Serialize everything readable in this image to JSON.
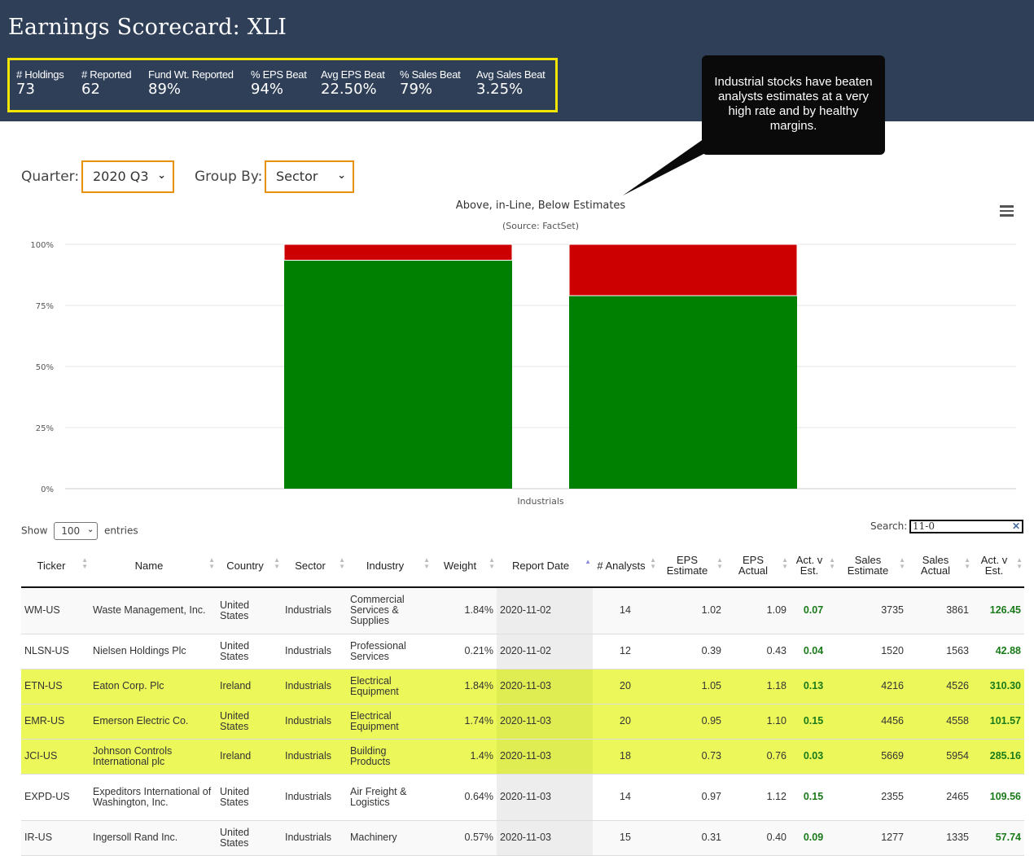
{
  "header": {
    "title": "Earnings Scorecard: XLI",
    "stats": [
      {
        "label": "# Holdings",
        "value": "73"
      },
      {
        "label": "# Reported",
        "value": "62"
      },
      {
        "label": "Fund Wt. Reported",
        "value": "89%"
      },
      {
        "label": "% EPS Beat",
        "value": "94%"
      },
      {
        "label": "Avg EPS Beat",
        "value": "22.50%"
      },
      {
        "label": "% Sales Beat",
        "value": "79%"
      },
      {
        "label": "Avg Sales Beat",
        "value": "3.25%"
      }
    ]
  },
  "callout": "Industrial stocks have beaten analysts estimates at a very high rate and by healthy margins.",
  "controls": {
    "quarter_label": "Quarter:",
    "quarter_value": "2020 Q3",
    "group_label": "Group By:",
    "group_value": "Sector"
  },
  "chart_data": {
    "type": "bar",
    "title": "Above, in-Line, Below Estimates",
    "subtitle": "(Source: FactSet)",
    "categories": [
      "Industrials"
    ],
    "y_ticks": [
      "0%",
      "25%",
      "50%",
      "75%",
      "100%"
    ],
    "ylim": [
      0,
      100
    ],
    "stacked": true,
    "bars": [
      {
        "above": 93.5,
        "below": 6.5
      },
      {
        "above": 79,
        "below": 21
      }
    ],
    "colors": {
      "above": "#008000",
      "below": "#cc0000"
    }
  },
  "table_controls": {
    "show_label": "Show",
    "entries_value": "100",
    "entries_label": "entries",
    "search_label": "Search:",
    "search_value": "11-0"
  },
  "table": {
    "headers": [
      "Ticker",
      "Name",
      "Country",
      "Sector",
      "Industry",
      "Weight",
      "Report Date",
      "# Analysts",
      "EPS Estimate",
      "EPS Actual",
      "Act. v Est.",
      "Sales Estimate",
      "Sales Actual",
      "Act. v Est."
    ],
    "rows": [
      {
        "ticker": "WM-US",
        "name": "Waste Management, Inc.",
        "country": "United States",
        "sector": "Industrials",
        "industry": "Commercial Services & Supplies",
        "weight": "1.84%",
        "date": "2020-11-02",
        "analysts": "14",
        "eps_est": "1.02",
        "eps_act": "1.09",
        "eps_diff": "0.07",
        "sales_est": "3735",
        "sales_act": "3861",
        "sales_diff": "126.45",
        "highlight": false
      },
      {
        "ticker": "NLSN-US",
        "name": "Nielsen Holdings Plc",
        "country": "United States",
        "sector": "Industrials",
        "industry": "Professional Services",
        "weight": "0.21%",
        "date": "2020-11-02",
        "analysts": "12",
        "eps_est": "0.39",
        "eps_act": "0.43",
        "eps_diff": "0.04",
        "sales_est": "1520",
        "sales_act": "1563",
        "sales_diff": "42.88",
        "highlight": false
      },
      {
        "ticker": "ETN-US",
        "name": "Eaton Corp. Plc",
        "country": "Ireland",
        "sector": "Industrials",
        "industry": "Electrical Equipment",
        "weight": "1.84%",
        "date": "2020-11-03",
        "analysts": "20",
        "eps_est": "1.05",
        "eps_act": "1.18",
        "eps_diff": "0.13",
        "sales_est": "4216",
        "sales_act": "4526",
        "sales_diff": "310.30",
        "highlight": true
      },
      {
        "ticker": "EMR-US",
        "name": "Emerson Electric Co.",
        "country": "United States",
        "sector": "Industrials",
        "industry": "Electrical Equipment",
        "weight": "1.74%",
        "date": "2020-11-03",
        "analysts": "20",
        "eps_est": "0.95",
        "eps_act": "1.10",
        "eps_diff": "0.15",
        "sales_est": "4456",
        "sales_act": "4558",
        "sales_diff": "101.57",
        "highlight": true
      },
      {
        "ticker": "JCI-US",
        "name": "Johnson Controls International plc",
        "country": "Ireland",
        "sector": "Industrials",
        "industry": "Building Products",
        "weight": "1.4%",
        "date": "2020-11-03",
        "analysts": "18",
        "eps_est": "0.73",
        "eps_act": "0.76",
        "eps_diff": "0.03",
        "sales_est": "5669",
        "sales_act": "5954",
        "sales_diff": "285.16",
        "highlight": true
      },
      {
        "ticker": "EXPD-US",
        "name": "Expeditors International of Washington, Inc.",
        "country": "United States",
        "sector": "Industrials",
        "industry": "Air Freight & Logistics",
        "weight": "0.64%",
        "date": "2020-11-03",
        "analysts": "14",
        "eps_est": "0.97",
        "eps_act": "1.12",
        "eps_diff": "0.15",
        "sales_est": "2355",
        "sales_act": "2465",
        "sales_diff": "109.56",
        "highlight": false
      },
      {
        "ticker": "IR-US",
        "name": "Ingersoll Rand Inc.",
        "country": "United States",
        "sector": "Industrials",
        "industry": "Machinery",
        "weight": "0.57%",
        "date": "2020-11-03",
        "analysts": "15",
        "eps_est": "0.31",
        "eps_act": "0.40",
        "eps_diff": "0.09",
        "sales_est": "1277",
        "sales_act": "1335",
        "sales_diff": "57.74",
        "highlight": false
      }
    ]
  }
}
